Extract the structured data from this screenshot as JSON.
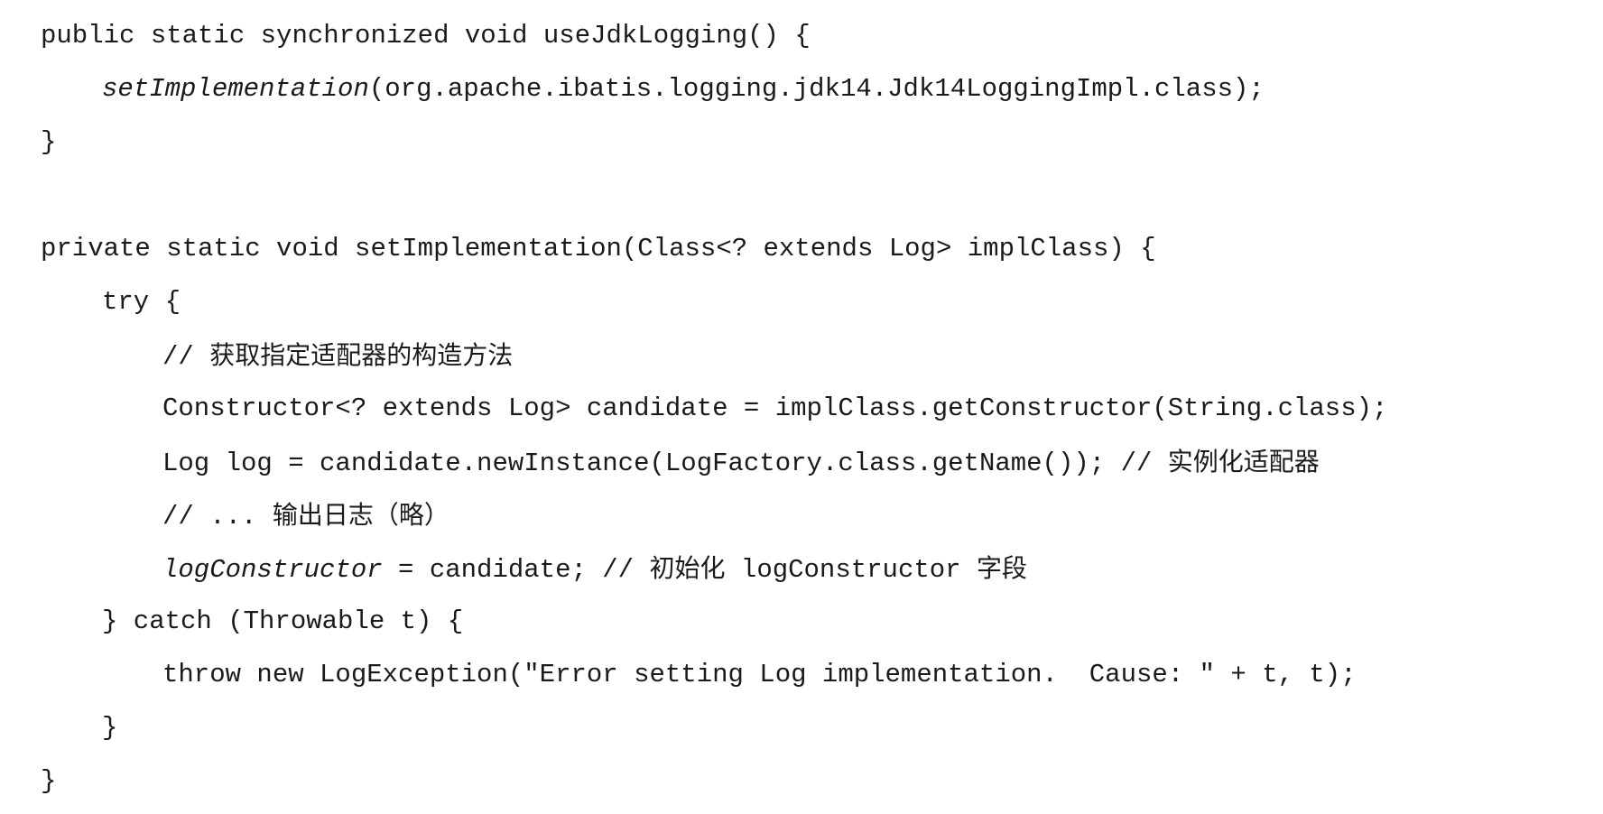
{
  "code": {
    "l1": "public static synchronized void useJdkLogging() {",
    "l2_method": "setImplementation",
    "l2_rest": "(org.apache.ibatis.logging.jdk14.Jdk14LoggingImpl.class);",
    "l3": "}",
    "l5": "private static void setImplementation(Class<? extends Log> implClass) {",
    "l6": "try {",
    "l7_prefix": "// ",
    "l7_comment": "获取指定适配器的构造方法",
    "l8": "Constructor<? extends Log> candidate = implClass.getConstructor(String.class);",
    "l9_code": "Log log = candidate.newInstance(LogFactory.class.getName()); // ",
    "l9_comment": "实例化适配器",
    "l10_prefix": "// ... ",
    "l10_comment": "输出日志（略）",
    "l11_field": "logConstructor",
    "l11_code": " = candidate; // ",
    "l11_comment_a": "初始化",
    "l11_comment_field": " logConstructor ",
    "l11_comment_b": "字段",
    "l12": "} catch (Throwable t) {",
    "l13": "throw new LogException(\"Error setting Log implementation.  Cause: \" + t, t);",
    "l14": "}",
    "l15": "}"
  }
}
